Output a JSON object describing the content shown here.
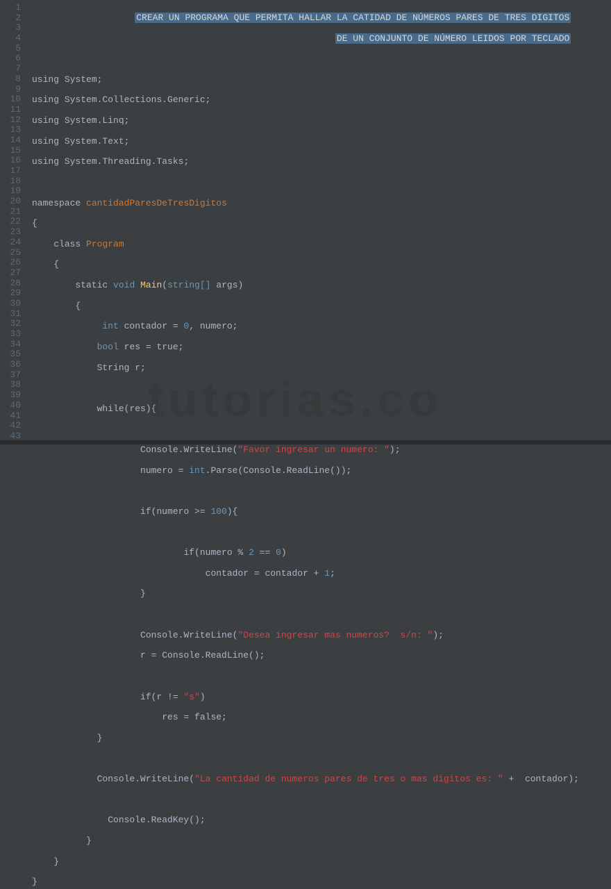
{
  "lineCount": 43,
  "watermark": "tutorias.co",
  "comment": {
    "line1": "CREAR UN PROGRAMA QUE PERMITA HALLAR LA CATIDAD DE NÚMEROS PARES DE TRES DIGITOS",
    "line2": "DE UN CONJUNTO DE NÚMERO LEIDOS POR TECLADO"
  },
  "code": {
    "using": "using",
    "system": "System;",
    "collections": "System.Collections.Generic;",
    "linq": "System.Linq;",
    "text": "System.Text;",
    "tasks": "System.Threading.Tasks;",
    "namespace": "namespace",
    "nsName": "cantidadParesDeTresDigitos",
    "lbrace": "{",
    "rbrace": "}",
    "class": "class",
    "className": "Program",
    "static": "static",
    "void": "void",
    "main": "Main",
    "stringArr": "string[]",
    "args": " args)",
    "int": "int",
    "contadorDecl": " contador = ",
    "zero": "0",
    "numeroDecl": ", numero;",
    "bool": "bool",
    "resTrue": " res = true;",
    "stringR": "String r;",
    "while": "while",
    "resCond": "(res){",
    "cwrite": "Console.WriteLine(",
    "str1": "\"Favor ingresar un numero: \"",
    "closeParenSemi": ");",
    "numeroAssign": "numero = ",
    "parse": ".Parse(Console.ReadLine());",
    "if": "if",
    "cond1": "(numero >= ",
    "hundred": "100",
    "closeCondBrace": "){",
    "cond2a": "(numero % ",
    "two": "2",
    "eqeq": " == ",
    "closeParen": ")",
    "contadorInc": "contador = contador + ",
    "one": "1",
    "semi": ";",
    "closeBrace": "}",
    "str2": "\"Desea ingresar mas numeros?  s/n: \"",
    "rAssign": "r = Console.ReadLine();",
    "cond3": "(r != ",
    "strS": "\"s\"",
    "resFalse": "res = false;",
    "str3": "\"La cantidad de numeros pares de tres o mas digitos es: \"",
    "plusContador": " +  contador);",
    "readkey": "Console.ReadKey();"
  }
}
